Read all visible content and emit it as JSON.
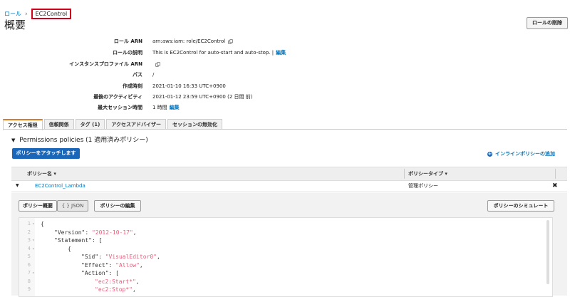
{
  "breadcrumb": {
    "parent": "ロール",
    "separator": "›",
    "current": "EC2Control"
  },
  "page": {
    "title": "概要",
    "delete_button": "ロールの削除"
  },
  "summary": [
    {
      "label": "ロール ARN",
      "value": "arn:aws:iam:                          role/EC2Control",
      "has_copy": true,
      "edit": ""
    },
    {
      "label": "ロールの説明",
      "value": "This is EC2Control for auto-start and auto-stop.  |",
      "has_copy": false,
      "edit": "編集"
    },
    {
      "label": "インスタンスプロファイル ARN",
      "value": "",
      "has_copy": true,
      "edit": ""
    },
    {
      "label": "パス",
      "value": "/",
      "has_copy": false,
      "edit": ""
    },
    {
      "label": "作成時刻",
      "value": "2021-01-10 16:33 UTC+0900",
      "has_copy": false,
      "edit": ""
    },
    {
      "label": "最後のアクティビティ",
      "value": "2021-01-12 23:59 UTC+0900 (2 日間 前)",
      "has_copy": false,
      "edit": ""
    },
    {
      "label": "最大セッション時間",
      "value": "1 時間",
      "has_copy": false,
      "edit": "編集"
    }
  ],
  "tabs": [
    {
      "label": "アクセス権限",
      "active": true
    },
    {
      "label": "信頼関係",
      "active": false
    },
    {
      "label": "タグ (1)",
      "active": false
    },
    {
      "label": "アクセスアドバイザー",
      "active": false
    },
    {
      "label": "セッションの無効化",
      "active": false
    }
  ],
  "permissions": {
    "heading": "Permissions policies (1 適用済みポリシー)",
    "attach_button": "ポリシーをアタッチします",
    "inline_link": "インラインポリシーの追加",
    "columns": {
      "name": "ポリシー名 ▾",
      "type": "ポリシータイプ ▾"
    },
    "rows": [
      {
        "name": "EC2Control_Lambda",
        "type": "管理ポリシー"
      }
    ]
  },
  "detail": {
    "summary_button": "ポリシー概要",
    "json_button": "{ } JSON",
    "edit_button": "ポリシーの編集",
    "simulate_button": "ポリシーのシミュレート"
  },
  "code": [
    {
      "n": "1",
      "fold": "▾",
      "indent": 0,
      "parts": [
        {
          "t": "{",
          "s": false
        }
      ]
    },
    {
      "n": "2",
      "fold": "",
      "indent": 1,
      "parts": [
        {
          "t": "\"Version\": ",
          "s": false
        },
        {
          "t": "\"2012-10-17\"",
          "s": true
        },
        {
          "t": ",",
          "s": false
        }
      ]
    },
    {
      "n": "3",
      "fold": "▾",
      "indent": 1,
      "parts": [
        {
          "t": "\"Statement\": [",
          "s": false
        }
      ]
    },
    {
      "n": "4",
      "fold": "▾",
      "indent": 2,
      "parts": [
        {
          "t": "{",
          "s": false
        }
      ]
    },
    {
      "n": "5",
      "fold": "",
      "indent": 3,
      "parts": [
        {
          "t": "\"Sid\": ",
          "s": false
        },
        {
          "t": "\"VisualEditor0\"",
          "s": true
        },
        {
          "t": ",",
          "s": false
        }
      ]
    },
    {
      "n": "6",
      "fold": "",
      "indent": 3,
      "parts": [
        {
          "t": "\"Effect\": ",
          "s": false
        },
        {
          "t": "\"Allow\"",
          "s": true
        },
        {
          "t": ",",
          "s": false
        }
      ]
    },
    {
      "n": "7",
      "fold": "▾",
      "indent": 3,
      "parts": [
        {
          "t": "\"Action\": [",
          "s": false
        }
      ]
    },
    {
      "n": "8",
      "fold": "",
      "indent": 4,
      "parts": [
        {
          "t": "\"ec2:Start*\"",
          "s": true
        },
        {
          "t": ",",
          "s": false
        }
      ]
    },
    {
      "n": "9",
      "fold": "",
      "indent": 4,
      "parts": [
        {
          "t": "\"ec2:Stop*\"",
          "s": true
        },
        {
          "t": ",",
          "s": false
        }
      ]
    }
  ]
}
